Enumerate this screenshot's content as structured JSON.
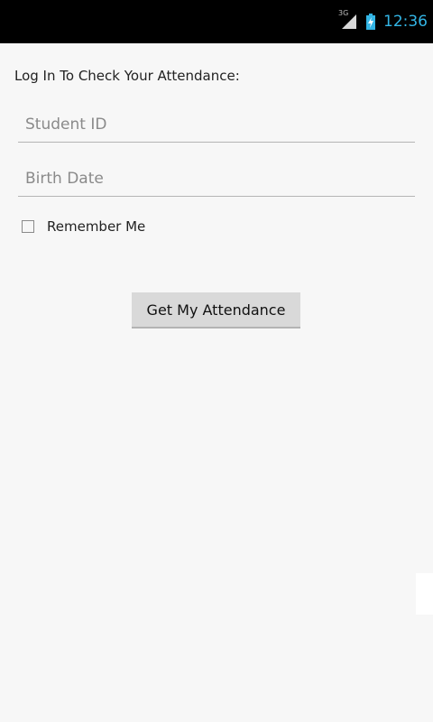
{
  "status_bar": {
    "network_type": "3G",
    "signal_icon": "cell-signal-icon",
    "battery_icon": "battery-charging-icon",
    "time": "12:36",
    "accent_color": "#33b5e5"
  },
  "form": {
    "prompt": "Log In To Check Your Attendance:",
    "student_id": {
      "value": "",
      "placeholder": "Student ID"
    },
    "birth_date": {
      "value": "",
      "placeholder": "Birth Date"
    },
    "remember": {
      "label": "Remember Me",
      "checked": false
    },
    "submit_label": "Get My Attendance"
  }
}
